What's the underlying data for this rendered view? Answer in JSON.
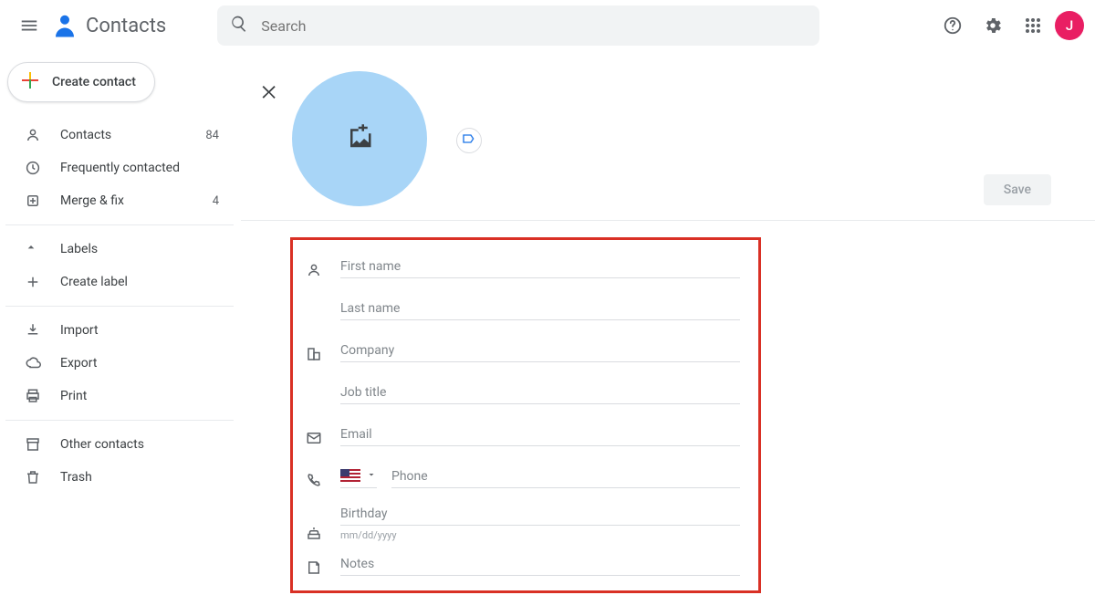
{
  "header": {
    "app_name": "Contacts",
    "search_placeholder": "Search",
    "profile_initial": "J"
  },
  "sidebar": {
    "create_label": "Create contact",
    "items": [
      {
        "label": "Contacts",
        "count": "84"
      },
      {
        "label": "Frequently contacted"
      },
      {
        "label": "Merge & fix",
        "count": "4"
      }
    ],
    "labels_header": "Labels",
    "create_label_label": "Create label",
    "actions": [
      {
        "label": "Import"
      },
      {
        "label": "Export"
      },
      {
        "label": "Print"
      }
    ],
    "footer": [
      {
        "label": "Other contacts"
      },
      {
        "label": "Trash"
      }
    ]
  },
  "detail": {
    "save_label": "Save",
    "form": {
      "first_name_ph": "First name",
      "last_name_ph": "Last name",
      "company_ph": "Company",
      "job_title_ph": "Job title",
      "email_ph": "Email",
      "phone_ph": "Phone",
      "birthday_ph": "Birthday",
      "birthday_helper": "mm/dd/yyyy",
      "notes_ph": "Notes"
    }
  }
}
